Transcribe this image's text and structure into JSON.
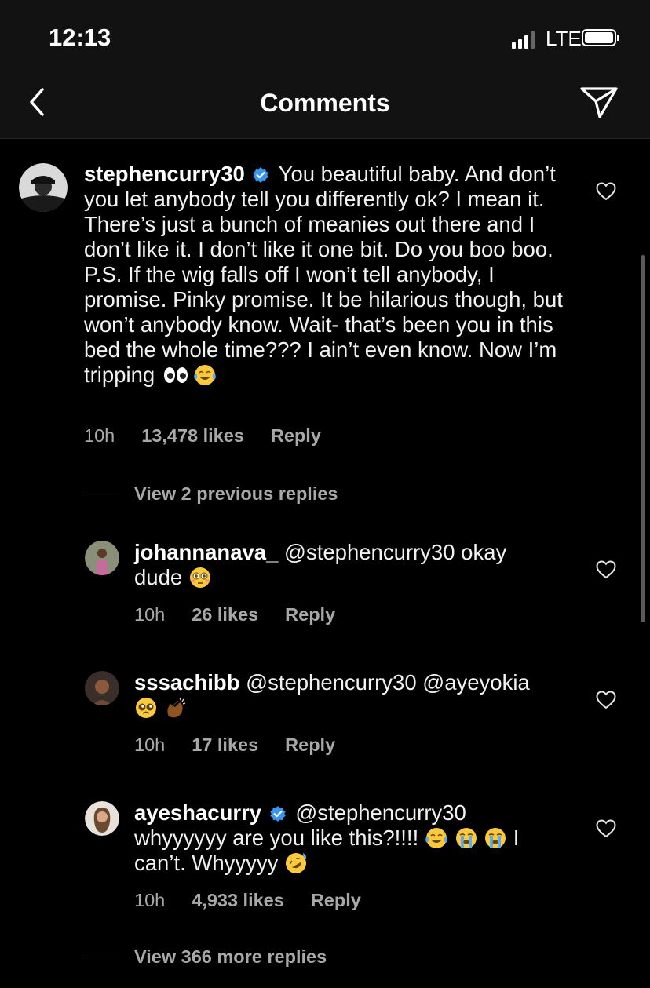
{
  "status_bar": {
    "time": "12:13",
    "network": "LTE"
  },
  "nav": {
    "title": "Comments"
  },
  "comments": [
    {
      "username": "stephencurry30",
      "verified": true,
      "text": "You beautiful baby. And don’t you let anybody tell you differently ok? I mean it. There’s just a bunch of meanies out there and I don’t like it. I don’t like it one bit. Do you boo boo. P.S. If the wig falls off I won’t tell anybody, I promise. Pinky promise. It be hilarious though, but won’t anybody know. Wait- that’s been you in this bed the whole time??? I ain’t even know. Now I’m tripping",
      "emojis": [
        "eyes",
        "joy"
      ],
      "time": "10h",
      "likes": "13,478 likes",
      "reply": "Reply"
    },
    {
      "username": "johannanava_",
      "text": "@stephencurry30 okay dude",
      "emojis": [
        "flushed"
      ],
      "time": "10h",
      "likes": "26 likes",
      "reply": "Reply"
    },
    {
      "username": "sssachibb",
      "text": "@stephencurry30 @ayeyokia",
      "emojis": [
        "pleading",
        "clapping-hands"
      ],
      "time": "10h",
      "likes": "17 likes",
      "reply": "Reply"
    },
    {
      "username": "ayeshacurry",
      "verified": true,
      "text_a": "@stephencurry30 whyyyyyy are you like this?!!!!",
      "text_b": "I can’t. Whyyyyy",
      "emojis": [
        "joy",
        "sob",
        "sob",
        "rofl"
      ],
      "time": "10h",
      "likes": "4,933 likes",
      "reply": "Reply"
    }
  ],
  "view_previous": "View 2 previous replies",
  "view_more": "View 366 more replies",
  "colors": {
    "background": "#000000",
    "bar": "#121212",
    "secondary_text": "#a8a8a8",
    "verified_blue": "#3897f0"
  }
}
